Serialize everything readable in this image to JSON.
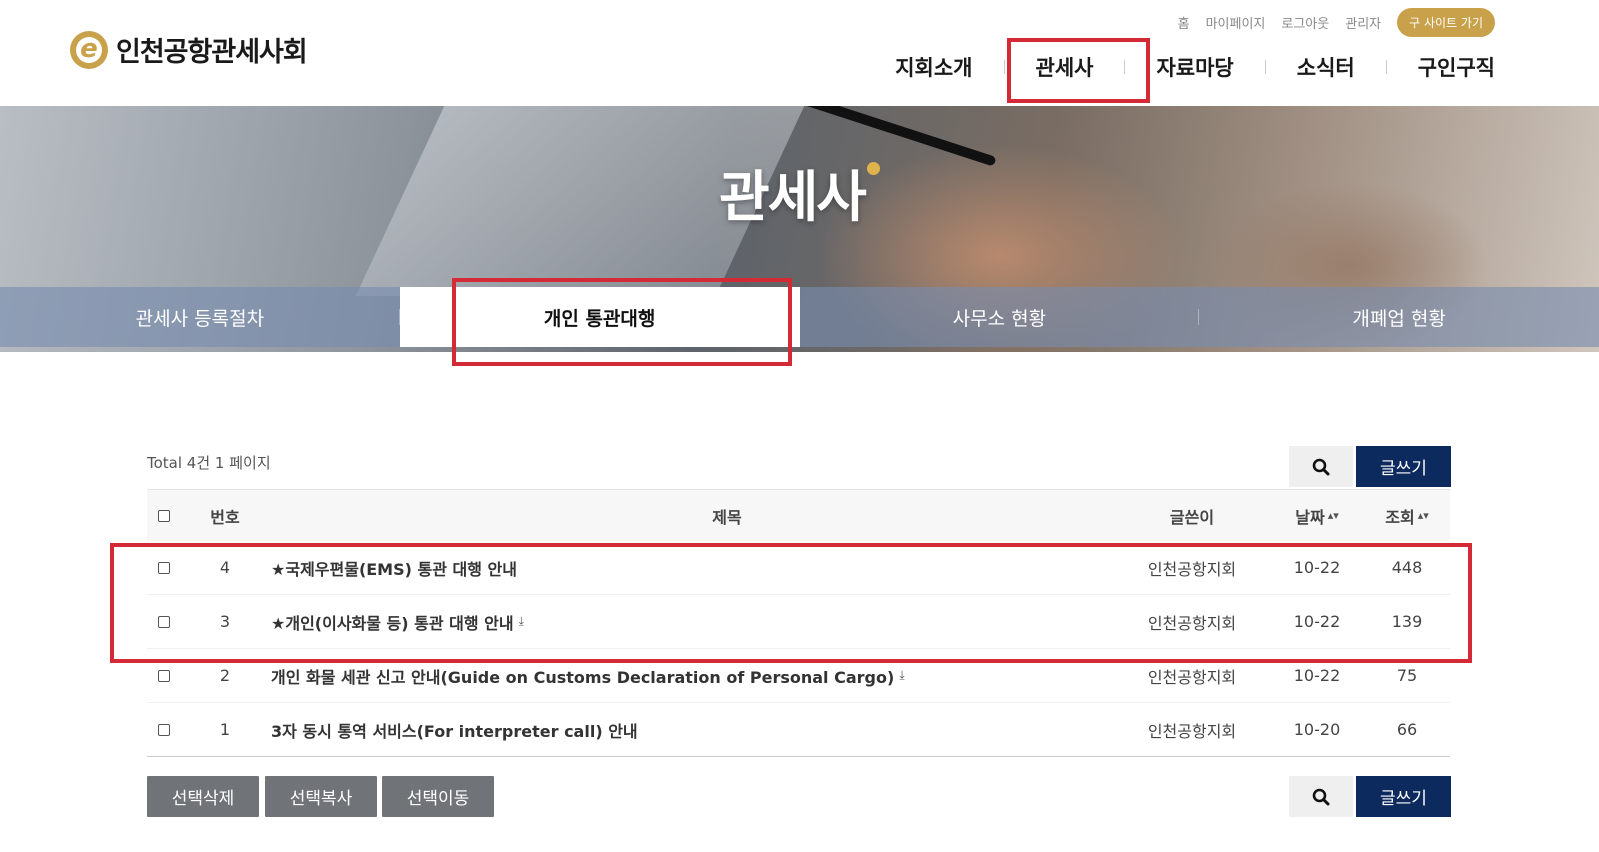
{
  "header": {
    "logo_text": "인천공항관세사회",
    "util_links": [
      "홈",
      "마이페이지",
      "로그아웃",
      "관리자"
    ],
    "old_site_label": "구 사이트 가기",
    "nav": [
      "지회소개",
      "관세사",
      "자료마당",
      "소식터",
      "구인구직"
    ]
  },
  "hero": {
    "title": "관세사"
  },
  "subtabs": [
    "관세사 등록절차",
    "개인 통관대행",
    "사무소 현황",
    "개폐업 현황"
  ],
  "board": {
    "total_text": "Total 4건 1 페이지",
    "write_label": "글쓰기",
    "columns": {
      "num": "번호",
      "title": "제목",
      "author": "글쓴이",
      "date": "날짜",
      "hits": "조회"
    },
    "rows": [
      {
        "num": "4",
        "title": "★국제우편물(EMS) 통관 대행 안내",
        "attachment": false,
        "author": "인천공항지회",
        "date": "10-22",
        "hits": "448"
      },
      {
        "num": "3",
        "title": "★개인(이사화물 등) 통관 대행 안내",
        "attachment": true,
        "author": "인천공항지회",
        "date": "10-22",
        "hits": "139"
      },
      {
        "num": "2",
        "title": "개인 화물 세관 신고 안내(Guide on Customs Declaration of Personal Cargo)",
        "attachment": true,
        "author": "인천공항지회",
        "date": "10-22",
        "hits": "75"
      },
      {
        "num": "1",
        "title": "3자 동시 통역 서비스(For interpreter call) 안내",
        "attachment": false,
        "author": "인천공항지회",
        "date": "10-20",
        "hits": "66"
      }
    ],
    "bottom_actions": [
      "선택삭제",
      "선택복사",
      "선택이동"
    ]
  },
  "colors": {
    "accent_gold": "#c9a14a",
    "navy_button": "#0c2a5e",
    "highlight_red": "#d42a36",
    "gray_button": "#707479"
  }
}
